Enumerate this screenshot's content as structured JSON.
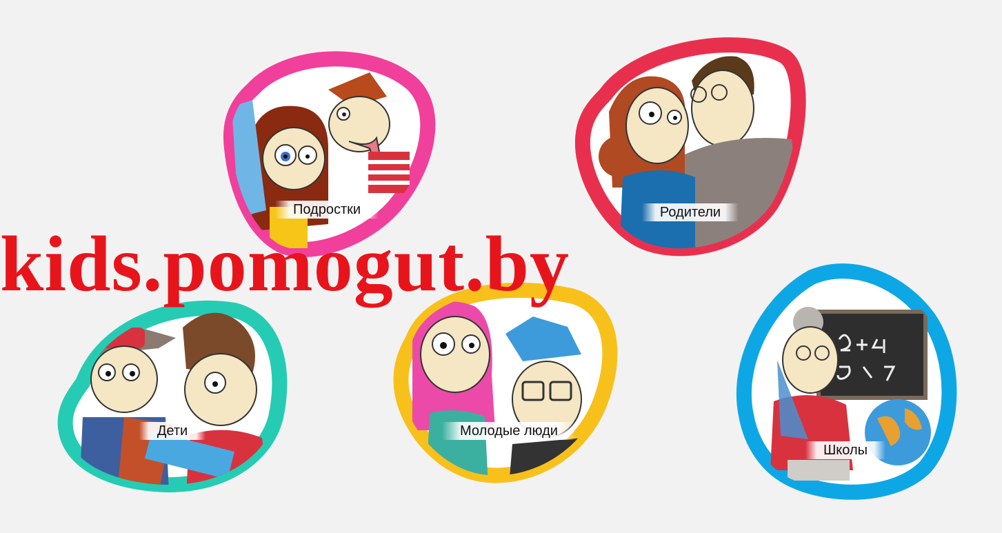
{
  "tiles": [
    {
      "label": "Подростки",
      "ring_color": "#f13f9c"
    },
    {
      "label": "Родители",
      "ring_color": "#e8304e"
    },
    {
      "label": "Дети",
      "ring_color": "#25ccb3"
    },
    {
      "label": "Молодые люди",
      "ring_color": "#f8c01a"
    },
    {
      "label": "Школы",
      "ring_color": "#0ea7e6"
    }
  ],
  "watermark": "kids.pomogut.by"
}
